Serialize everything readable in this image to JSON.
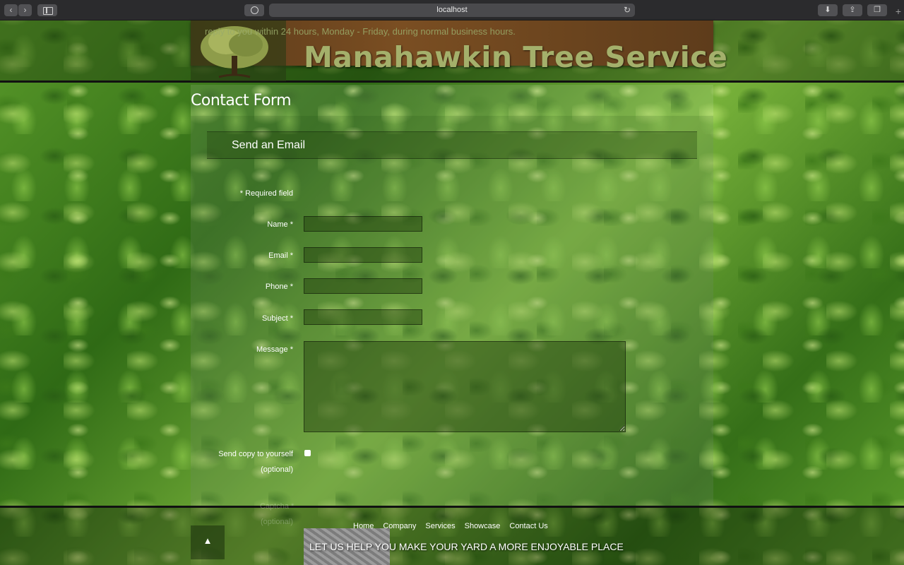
{
  "browser": {
    "url": "localhost",
    "back_icon": "chevron-left-icon",
    "forward_icon": "chevron-right-icon"
  },
  "header": {
    "tagline": "reply to you within 24 hours, Monday - Friday, during normal business hours.",
    "title": "Manahawkin Tree Service"
  },
  "page": {
    "heading": "Contact Form"
  },
  "form": {
    "legend": "Send an Email",
    "required_note": "* Required field",
    "name_label": "Name *",
    "email_label": "Email *",
    "phone_label": "Phone *",
    "subject_label": "Subject *",
    "message_label": "Message *",
    "copy_label": "Send copy to yourself",
    "copy_optional": "(optional)",
    "captcha_label": "Captcha *",
    "captcha_optional": "(optional)"
  },
  "footer": {
    "nav": [
      "Home",
      "Company",
      "Services",
      "Showcase",
      "Contact Us"
    ],
    "tagline": "LET US HELP YOU MAKE YOUR YARD A MORE ENJOYABLE PLACE",
    "back_to_top": "▲"
  },
  "colors": {
    "title": "#a4b06b",
    "banner": "#6b4420"
  }
}
